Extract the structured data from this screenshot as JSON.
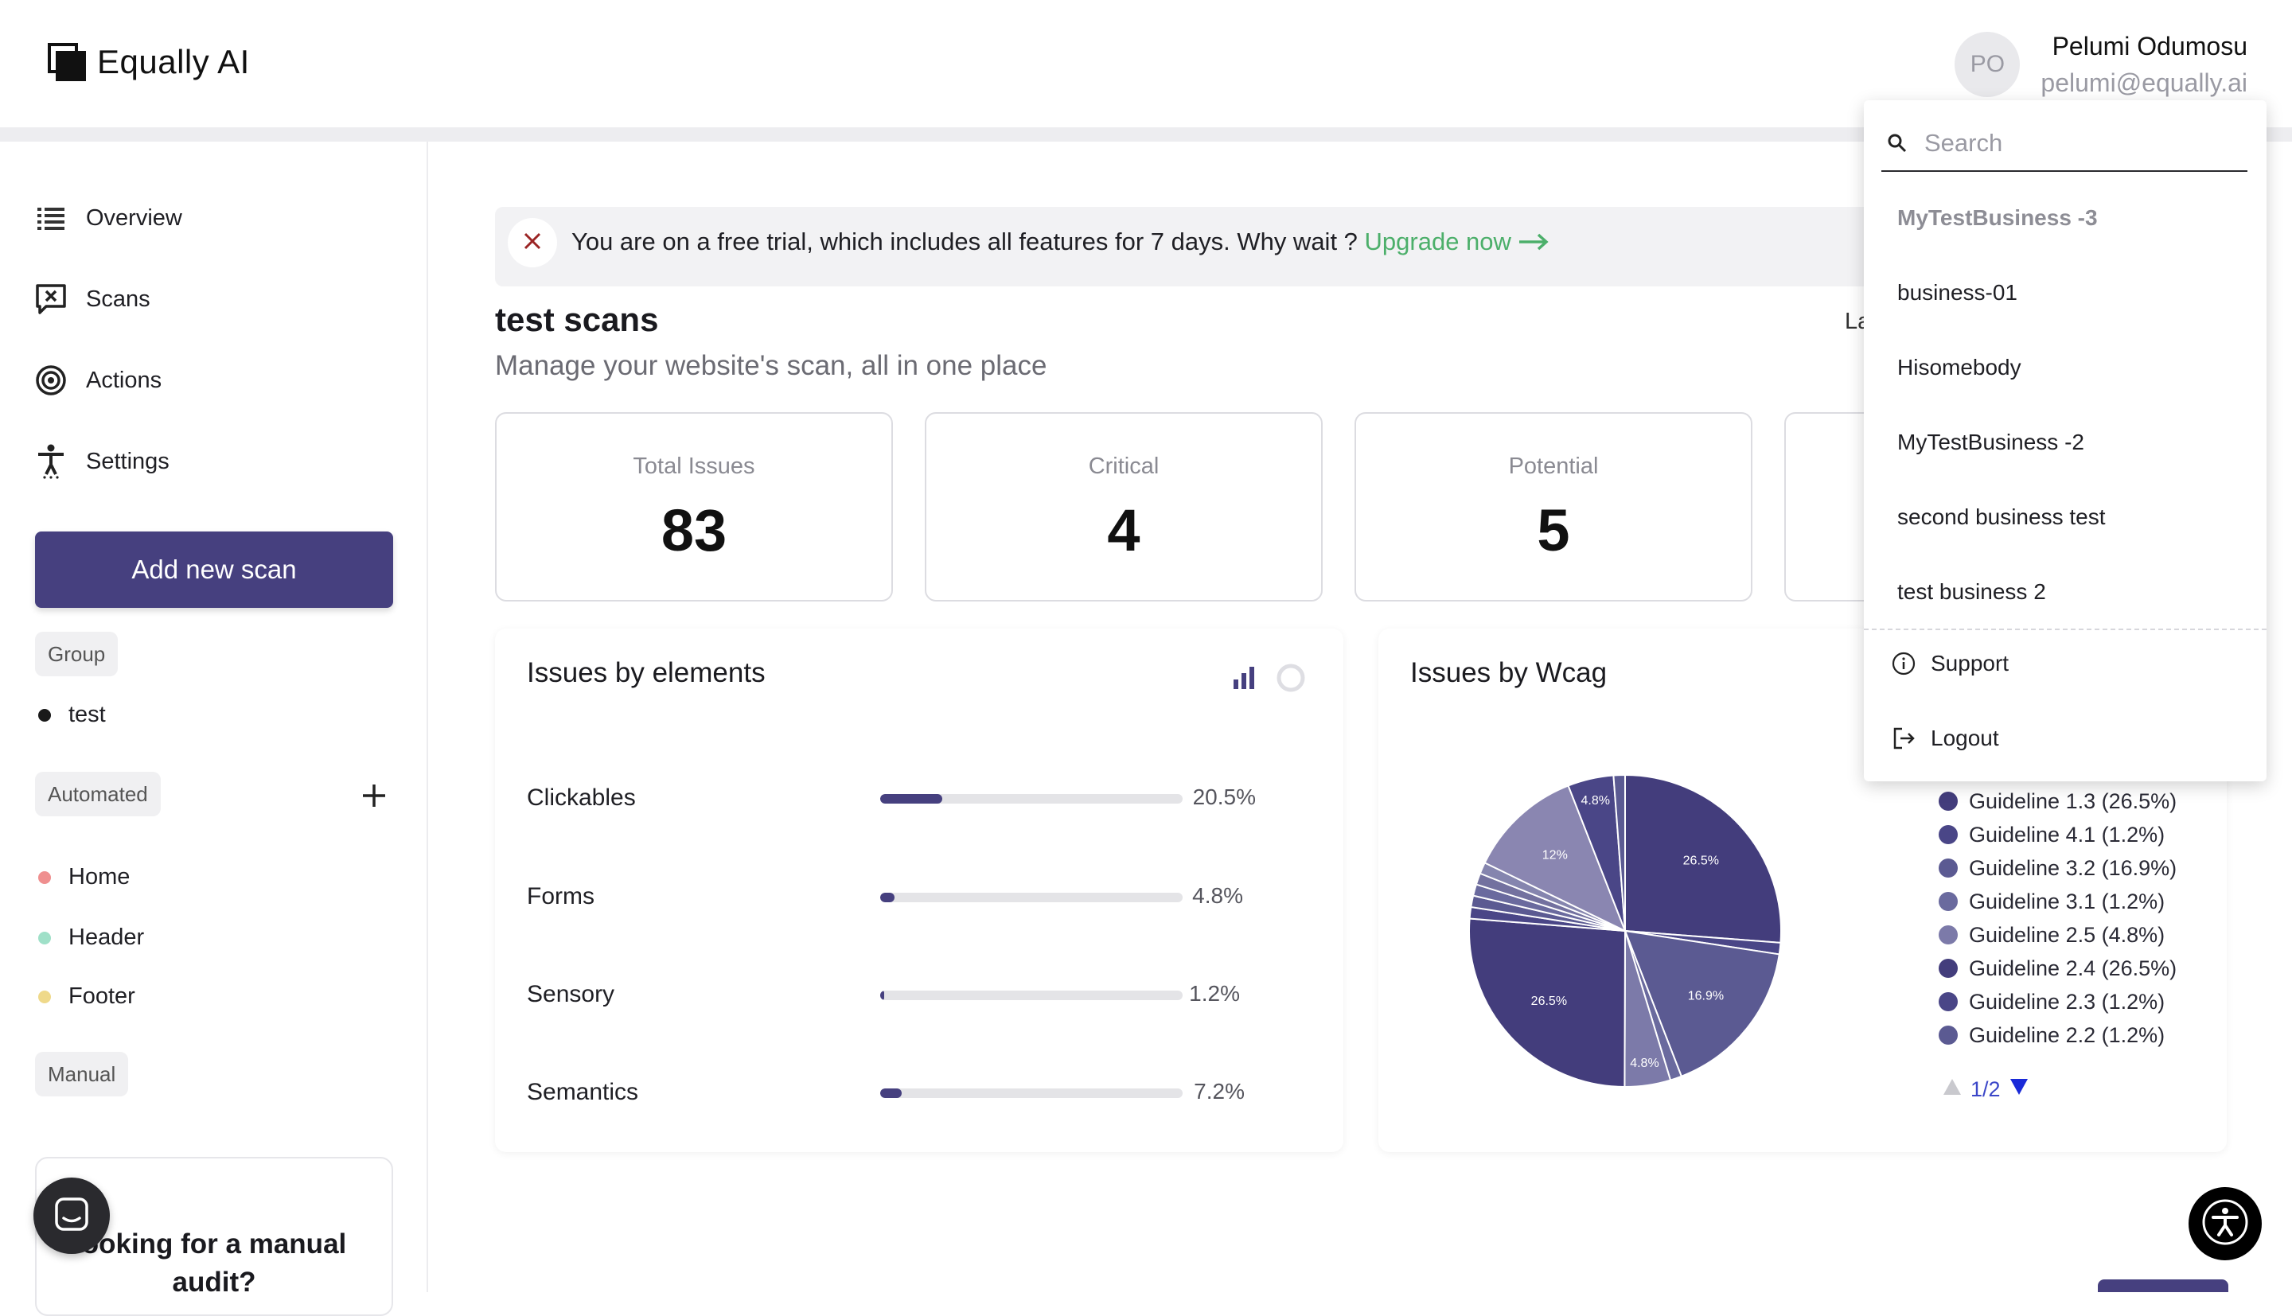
{
  "app": {
    "name": "Equally AI"
  },
  "user": {
    "initials": "PO",
    "name": "Pelumi Odumosu",
    "email": "pelumi@equally.ai"
  },
  "sidebar": {
    "nav": [
      {
        "label": "Overview",
        "icon": "list-icon"
      },
      {
        "label": "Scans",
        "icon": "scan-icon"
      },
      {
        "label": "Actions",
        "icon": "target-icon"
      },
      {
        "label": "Settings",
        "icon": "accessibility-icon"
      }
    ],
    "add_scan_label": "Add new scan",
    "group_label": "Group",
    "group_items": [
      {
        "label": "test",
        "color": "#1a1a1a"
      }
    ],
    "automated_label": "Automated",
    "automated_items": [
      {
        "label": "Home",
        "color": "#ef8f8f"
      },
      {
        "label": "Header",
        "color": "#9fe0c8"
      },
      {
        "label": "Footer",
        "color": "#efd98a"
      }
    ],
    "manual_label": "Manual",
    "audit_text": "ooking for a manual audit?"
  },
  "banner": {
    "text": "You are on a free trial, which includes all features for 7 days. Why wait ? ",
    "link": "Upgrade now"
  },
  "page": {
    "title": "test scans",
    "subtitle": "Manage your website's scan, all in one place",
    "cut_label": "La"
  },
  "stats": [
    {
      "label": "Total Issues",
      "value": "83"
    },
    {
      "label": "Critical",
      "value": "4"
    },
    {
      "label": "Potential",
      "value": "5"
    }
  ],
  "elements_card": {
    "title": "Issues by elements",
    "rows": [
      {
        "label": "Clickables",
        "pct_text": "20.5%",
        "value": 20.5
      },
      {
        "label": "Forms",
        "pct_text": "4.8%",
        "value": 4.8
      },
      {
        "label": "Sensory",
        "pct_text": "1.2%",
        "value": 1.2
      },
      {
        "label": "Semantics",
        "pct_text": "7.2%",
        "value": 7.2
      }
    ]
  },
  "wcag_card": {
    "title": "Issues by Wcag",
    "pager": "1/2"
  },
  "chart_data": {
    "type": "pie",
    "title": "Issues by Wcag",
    "slices": [
      {
        "label": "Guideline 1.3",
        "value": 26.5,
        "color": "#433d7c"
      },
      {
        "label": "Guideline 4.1",
        "value": 1.2,
        "color": "#4a4687"
      },
      {
        "label": "Guideline 3.2",
        "value": 16.9,
        "color": "#5b5a92"
      },
      {
        "label": "Guideline 3.1",
        "value": 1.2,
        "color": "#6a6a9e"
      },
      {
        "label": "Guideline 2.5",
        "value": 4.8,
        "color": "#7c7aa9"
      },
      {
        "label": "Guideline 2.4",
        "value": 26.5,
        "color": "#433d7c"
      },
      {
        "label": "Guideline 2.3",
        "value": 1.2,
        "color": "#4a4687"
      },
      {
        "label": "Guideline 2.2",
        "value": 1.2,
        "color": "#5b5a92"
      },
      {
        "label": "",
        "value": 1.2,
        "color": "#6a6a9e"
      },
      {
        "label": "",
        "value": 1.2,
        "color": "#73719f"
      },
      {
        "label": "",
        "value": 1.2,
        "color": "#8585ae"
      },
      {
        "label": "",
        "value": 12.0,
        "color": "#8a86b1"
      },
      {
        "label": "",
        "value": 4.8,
        "color": "#4a4687"
      },
      {
        "label": "",
        "value": 1.2,
        "color": "#5b5a92"
      }
    ],
    "data_labels": [
      "26.5%",
      "16.9%",
      "4.8%",
      "26.5%",
      "12%",
      "4.8%"
    ],
    "legend": [
      {
        "label": "Guideline 1.3 (26.5%)",
        "color": "#433d7c"
      },
      {
        "label": "Guideline 4.1 (1.2%)",
        "color": "#4a4687"
      },
      {
        "label": "Guideline 3.2 (16.9%)",
        "color": "#5b5a92"
      },
      {
        "label": "Guideline 3.1 (1.2%)",
        "color": "#6a6a9e"
      },
      {
        "label": "Guideline 2.5 (4.8%)",
        "color": "#7c7aa9"
      },
      {
        "label": "Guideline 2.4 (26.5%)",
        "color": "#433d7c"
      },
      {
        "label": "Guideline 2.3 (1.2%)",
        "color": "#4a4687"
      },
      {
        "label": "Guideline 2.2 (1.2%)",
        "color": "#5b5a92"
      }
    ]
  },
  "dropdown": {
    "search_placeholder": "Search",
    "businesses": [
      "MyTestBusiness -3",
      "business-01",
      "Hisomebody",
      "MyTestBusiness -2",
      "second business test",
      "test business 2"
    ],
    "support_label": "Support",
    "logout_label": "Logout"
  }
}
